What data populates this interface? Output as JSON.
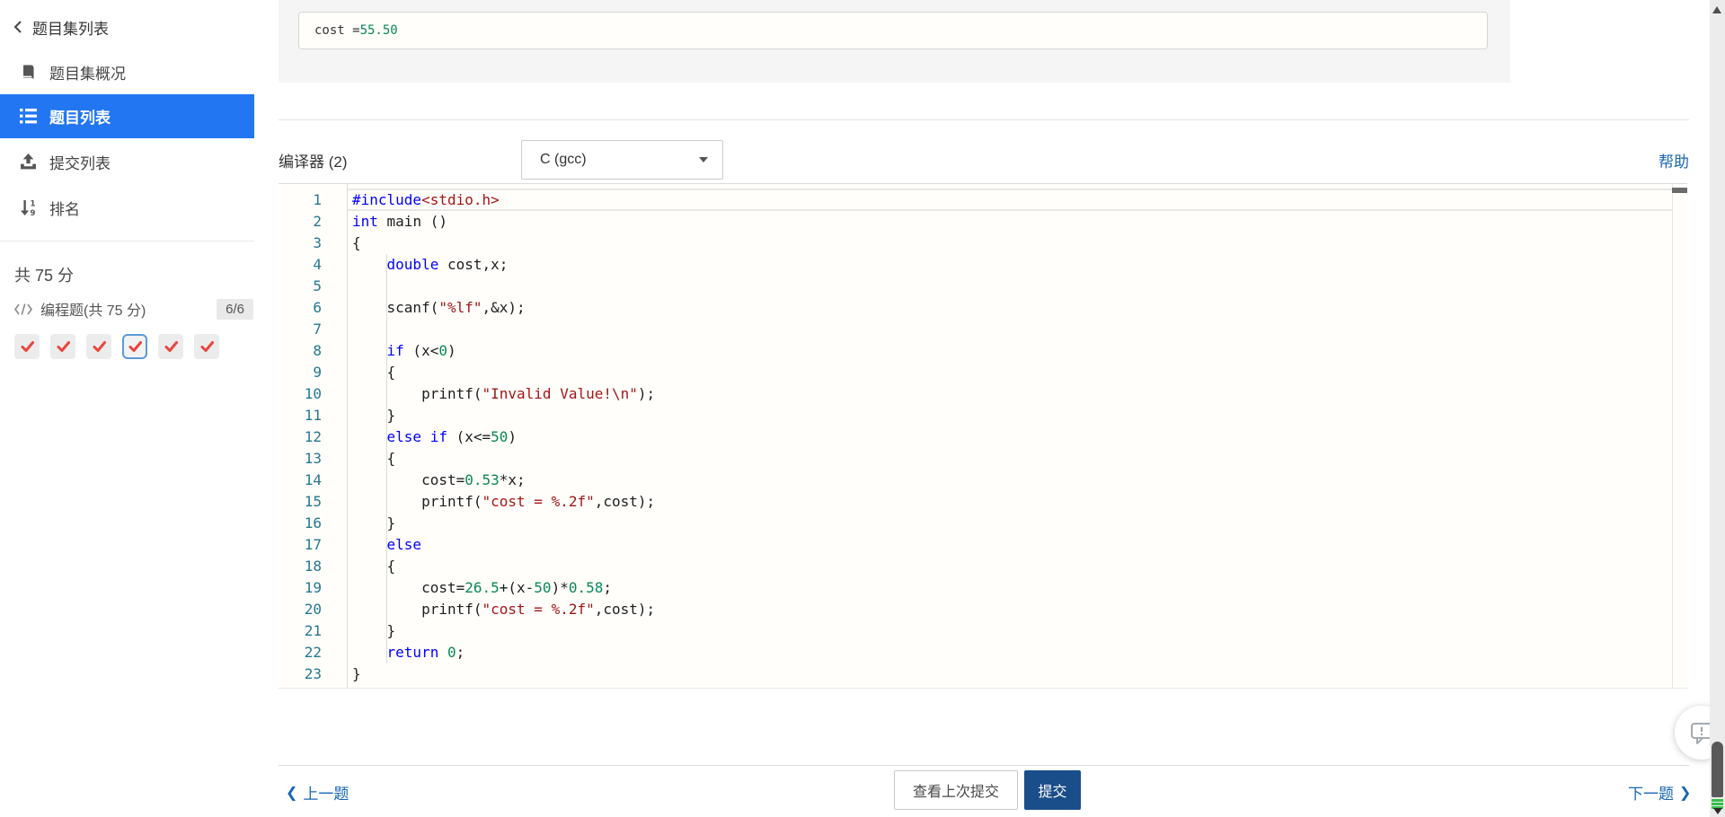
{
  "sidebar": {
    "back_label": "题目集列表",
    "items": [
      {
        "label": "题目集概况",
        "icon": "book"
      },
      {
        "label": "题目列表",
        "icon": "list",
        "active": true
      },
      {
        "label": "提交列表",
        "icon": "upload"
      },
      {
        "label": "排名",
        "icon": "sort-numeric"
      }
    ],
    "total_score": "共 75 分",
    "section": {
      "label": "编程题(共 75 分)",
      "icon": "code",
      "badge": "6/6"
    },
    "problems": [
      {
        "state": "correct",
        "current": false
      },
      {
        "state": "correct",
        "current": false
      },
      {
        "state": "correct",
        "current": false
      },
      {
        "state": "correct",
        "current": true
      },
      {
        "state": "correct",
        "current": false
      },
      {
        "state": "correct",
        "current": false
      }
    ]
  },
  "sample_output": {
    "label": "cost = ",
    "value": "55.50"
  },
  "compiler": {
    "label": "编译器 (2)",
    "selected_option": "C (gcc)",
    "help_label": "帮助"
  },
  "editor": {
    "language": "C",
    "lines": [
      {
        "n": "1",
        "s": [
          [
            "#include",
            "kw"
          ],
          [
            "<stdio.h>",
            "str"
          ]
        ]
      },
      {
        "n": "2",
        "s": [
          [
            "int",
            "kw"
          ],
          [
            " main ()",
            "pl"
          ]
        ]
      },
      {
        "n": "3",
        "s": [
          [
            "{",
            "pl"
          ]
        ]
      },
      {
        "n": "4",
        "s": [
          [
            "    ",
            "pl"
          ],
          [
            "double",
            "kw"
          ],
          [
            " cost,x;",
            "pl"
          ]
        ]
      },
      {
        "n": "5",
        "s": []
      },
      {
        "n": "6",
        "s": [
          [
            "    scanf(",
            "pl"
          ],
          [
            "\"%lf\"",
            "str"
          ],
          [
            ",&x);",
            "pl"
          ]
        ]
      },
      {
        "n": "7",
        "s": []
      },
      {
        "n": "8",
        "s": [
          [
            "    ",
            "pl"
          ],
          [
            "if",
            "kw"
          ],
          [
            " (x<",
            "pl"
          ],
          [
            "0",
            "num"
          ],
          [
            ")",
            "pl"
          ]
        ]
      },
      {
        "n": "9",
        "s": [
          [
            "    {",
            "pl"
          ]
        ]
      },
      {
        "n": "10",
        "s": [
          [
            "        printf(",
            "pl"
          ],
          [
            "\"Invalid Value!\\n\"",
            "str"
          ],
          [
            ");",
            "pl"
          ]
        ]
      },
      {
        "n": "11",
        "s": [
          [
            "    }",
            "pl"
          ]
        ]
      },
      {
        "n": "12",
        "s": [
          [
            "    ",
            "pl"
          ],
          [
            "else",
            "kw"
          ],
          [
            " ",
            "pl"
          ],
          [
            "if",
            "kw"
          ],
          [
            " (x<=",
            "pl"
          ],
          [
            "50",
            "num"
          ],
          [
            ")",
            "pl"
          ]
        ]
      },
      {
        "n": "13",
        "s": [
          [
            "    {",
            "pl"
          ]
        ]
      },
      {
        "n": "14",
        "s": [
          [
            "        cost=",
            "pl"
          ],
          [
            "0.53",
            "num"
          ],
          [
            "*x;",
            "pl"
          ]
        ]
      },
      {
        "n": "15",
        "s": [
          [
            "        printf(",
            "pl"
          ],
          [
            "\"cost = %.2f\"",
            "str"
          ],
          [
            ",cost);",
            "pl"
          ]
        ]
      },
      {
        "n": "16",
        "s": [
          [
            "    }",
            "pl"
          ]
        ]
      },
      {
        "n": "17",
        "s": [
          [
            "    ",
            "pl"
          ],
          [
            "else",
            "kw"
          ]
        ]
      },
      {
        "n": "18",
        "s": [
          [
            "    {",
            "pl"
          ]
        ]
      },
      {
        "n": "19",
        "s": [
          [
            "        cost=",
            "pl"
          ],
          [
            "26.5",
            "num"
          ],
          [
            "+(x-",
            "pl"
          ],
          [
            "50",
            "num"
          ],
          [
            ")*",
            "pl"
          ],
          [
            "0.58",
            "num"
          ],
          [
            ";",
            "pl"
          ]
        ]
      },
      {
        "n": "20",
        "s": [
          [
            "        printf(",
            "pl"
          ],
          [
            "\"cost = %.2f\"",
            "str"
          ],
          [
            ",cost);",
            "pl"
          ]
        ]
      },
      {
        "n": "21",
        "s": [
          [
            "    }",
            "pl"
          ]
        ]
      },
      {
        "n": "22",
        "s": [
          [
            "    ",
            "pl"
          ],
          [
            "return",
            "kw"
          ],
          [
            " ",
            "pl"
          ],
          [
            "0",
            "num"
          ],
          [
            ";",
            "pl"
          ]
        ]
      },
      {
        "n": "23",
        "s": [
          [
            "}",
            "pl"
          ]
        ]
      }
    ]
  },
  "footer": {
    "prev_label": "上一题",
    "view_last_label": "查看上次提交",
    "submit_label": "提交",
    "next_label": "下一题"
  },
  "colors": {
    "sidebar_active_bg": "#2276f2",
    "link_blue": "#1866b4",
    "submit_bg": "#1a4e8a",
    "check_red": "#e8453c",
    "selected_border": "#5a9bd8",
    "token_keyword": "#0000ff",
    "token_string": "#a31515",
    "token_number": "#098658",
    "line_number": "#237893",
    "sample_panel_bg": "#f5f5f5"
  }
}
